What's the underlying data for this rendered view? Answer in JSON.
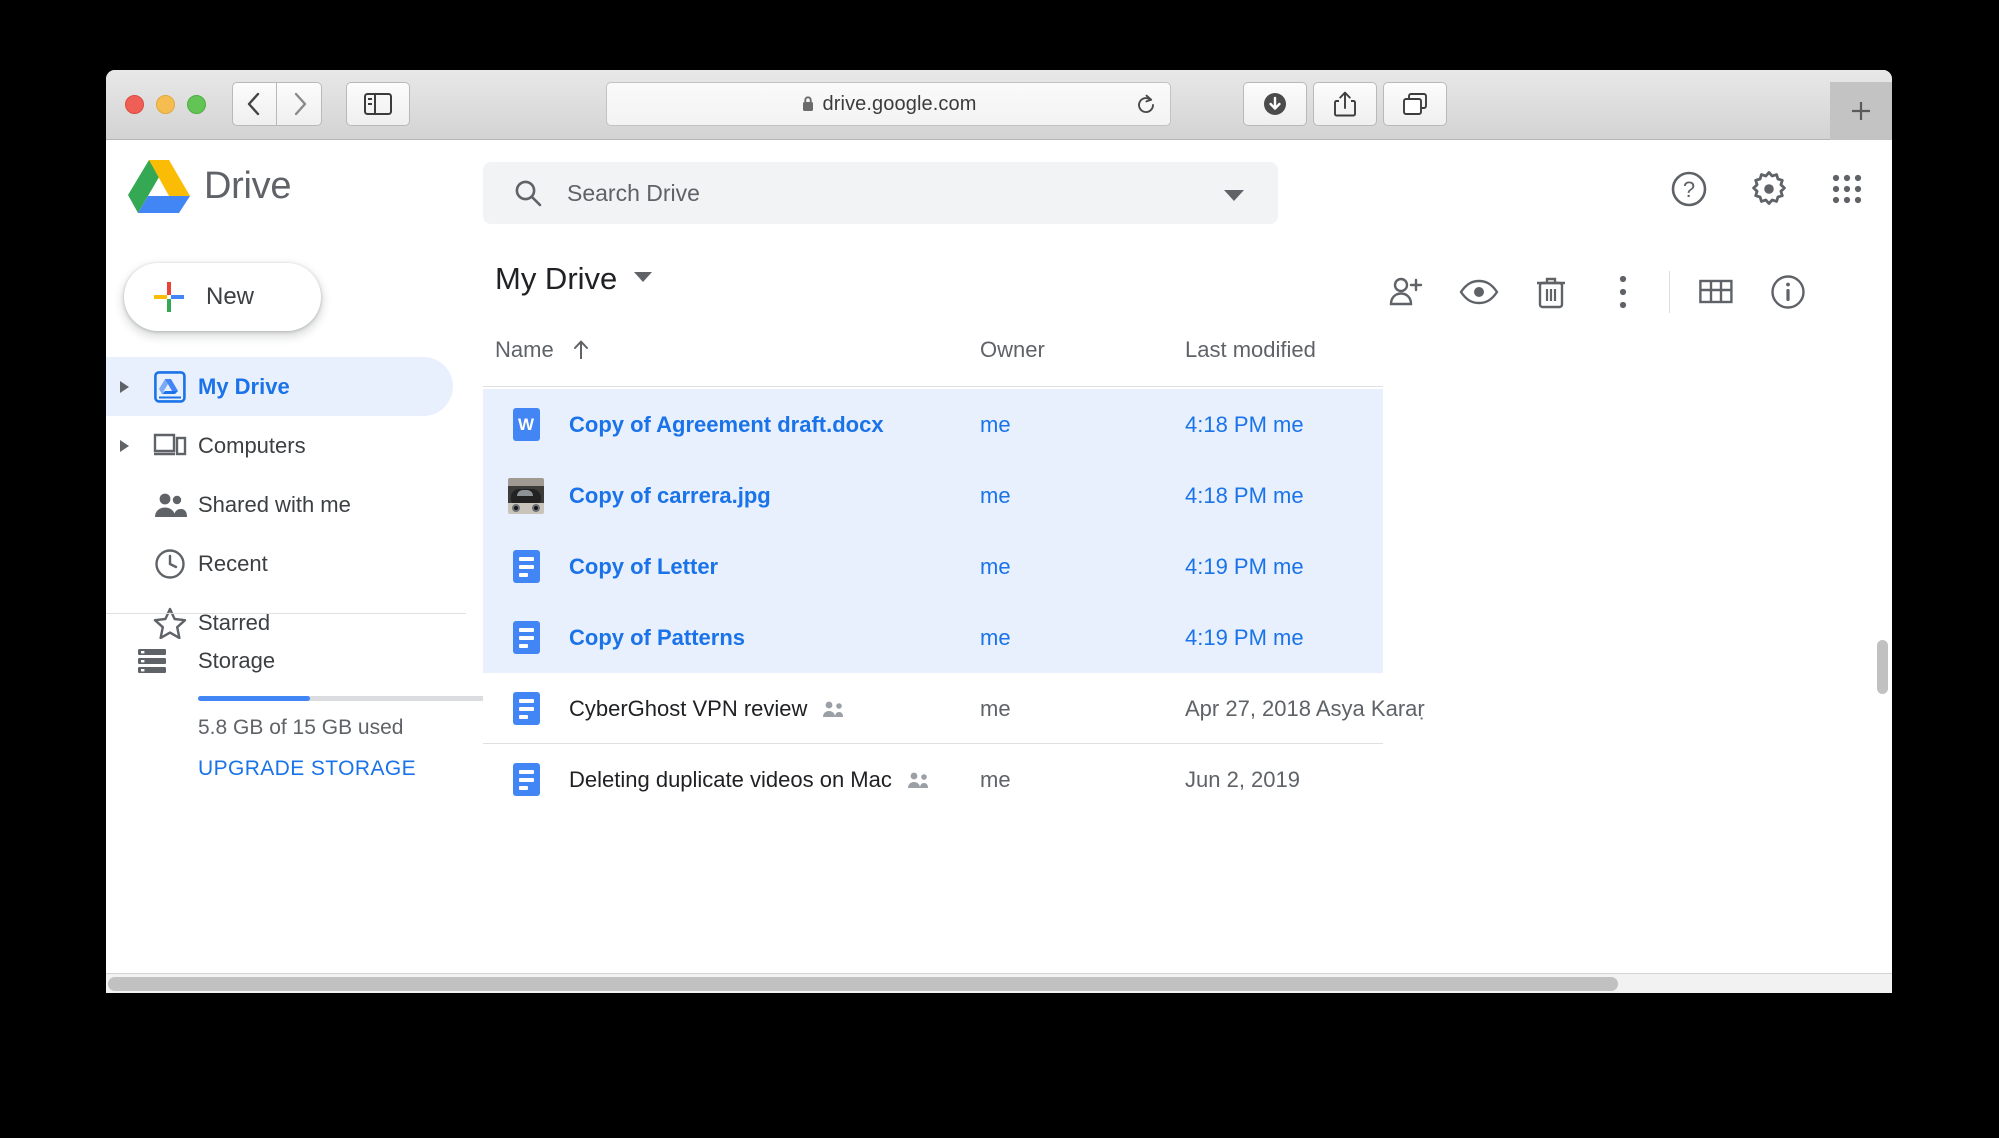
{
  "browser": {
    "url": "drive.google.com",
    "lock_icon": "lock-icon",
    "reload_icon": "reload-icon",
    "back_icon": "back-chevron-icon",
    "forward_icon": "forward-chevron-icon",
    "sidebar_icon": "sidebar-toggle-icon",
    "downloads_icon": "downloads-icon",
    "share_icon": "share-icon",
    "tabs_icon": "tab-overview-icon",
    "newtab_label": "+",
    "traffic_lights": [
      "close",
      "minimize",
      "maximize"
    ]
  },
  "header": {
    "app_name": "Drive",
    "logo_icon": "google-drive-logo",
    "search": {
      "placeholder": "Search Drive",
      "value": "",
      "search_icon": "search-icon",
      "options_icon": "chevron-down-icon"
    },
    "icons": [
      {
        "name": "help-icon",
        "glyph": "?"
      },
      {
        "name": "settings-gear-icon",
        "glyph": "gear"
      },
      {
        "name": "google-apps-grid-icon",
        "glyph": "grid"
      }
    ]
  },
  "sidebar": {
    "new_button": {
      "label": "New",
      "icon": "plus-icon"
    },
    "items": [
      {
        "label": "My Drive",
        "icon": "my-drive-icon",
        "active": true,
        "expandable": true
      },
      {
        "label": "Computers",
        "icon": "computers-icon",
        "active": false,
        "expandable": true
      },
      {
        "label": "Shared with me",
        "icon": "shared-with-me-icon",
        "active": false,
        "expandable": false
      },
      {
        "label": "Recent",
        "icon": "clock-icon",
        "active": false,
        "expandable": false
      },
      {
        "label": "Starred",
        "icon": "star-icon",
        "active": false,
        "expandable": false
      }
    ],
    "storage": {
      "label": "Storage",
      "icon": "storage-icon",
      "used_text": "5.8 GB of 15 GB used",
      "upgrade_label": "UPGRADE STORAGE",
      "used_percent": 38,
      "bar_color": "#4285f4"
    }
  },
  "main": {
    "breadcrumb": "My Drive",
    "breadcrumb_caret": "chevron-down-icon",
    "toolbar": [
      {
        "name": "add-person-icon",
        "title": "Share"
      },
      {
        "name": "preview-eye-icon",
        "title": "Preview"
      },
      {
        "name": "trash-icon",
        "title": "Remove"
      },
      {
        "name": "more-actions-icon",
        "title": "More actions"
      },
      {
        "name": "grid-view-icon",
        "title": "Grid view"
      },
      {
        "name": "details-info-icon",
        "title": "View details"
      }
    ],
    "columns": [
      {
        "label": "Name",
        "sort": "asc",
        "sort_icon": "arrow-up-icon"
      },
      {
        "label": "Owner"
      },
      {
        "label": "Last modified"
      }
    ],
    "files": [
      {
        "name": "Copy of Agreement draft.docx",
        "icon": "word-file-icon",
        "owner": "me",
        "modified": "4:18 PM  me",
        "selected": true,
        "shared": false
      },
      {
        "name": "Copy of carrera.jpg",
        "icon": "image-thumbnail",
        "owner": "me",
        "modified": "4:18 PM  me",
        "selected": true,
        "shared": false
      },
      {
        "name": "Copy of Letter",
        "icon": "google-docs-icon",
        "owner": "me",
        "modified": "4:19 PM  me",
        "selected": true,
        "shared": false
      },
      {
        "name": "Copy of Patterns",
        "icon": "google-docs-icon",
        "owner": "me",
        "modified": "4:19 PM  me",
        "selected": true,
        "shared": false
      },
      {
        "name": "CyberGhost VPN review",
        "icon": "google-docs-icon",
        "owner": "me",
        "modified": "Apr 27, 2018  Asya Karaṛ",
        "selected": false,
        "shared": true
      },
      {
        "name": "Deleting duplicate videos on Mac",
        "icon": "google-docs-icon",
        "owner": "me",
        "modified": "Jun 2, 2019",
        "selected": false,
        "shared": true
      }
    ]
  },
  "colors": {
    "accent": "#1a73e8",
    "selection": "#e8f0fe",
    "text": "#202124",
    "muted": "#5f6368"
  }
}
